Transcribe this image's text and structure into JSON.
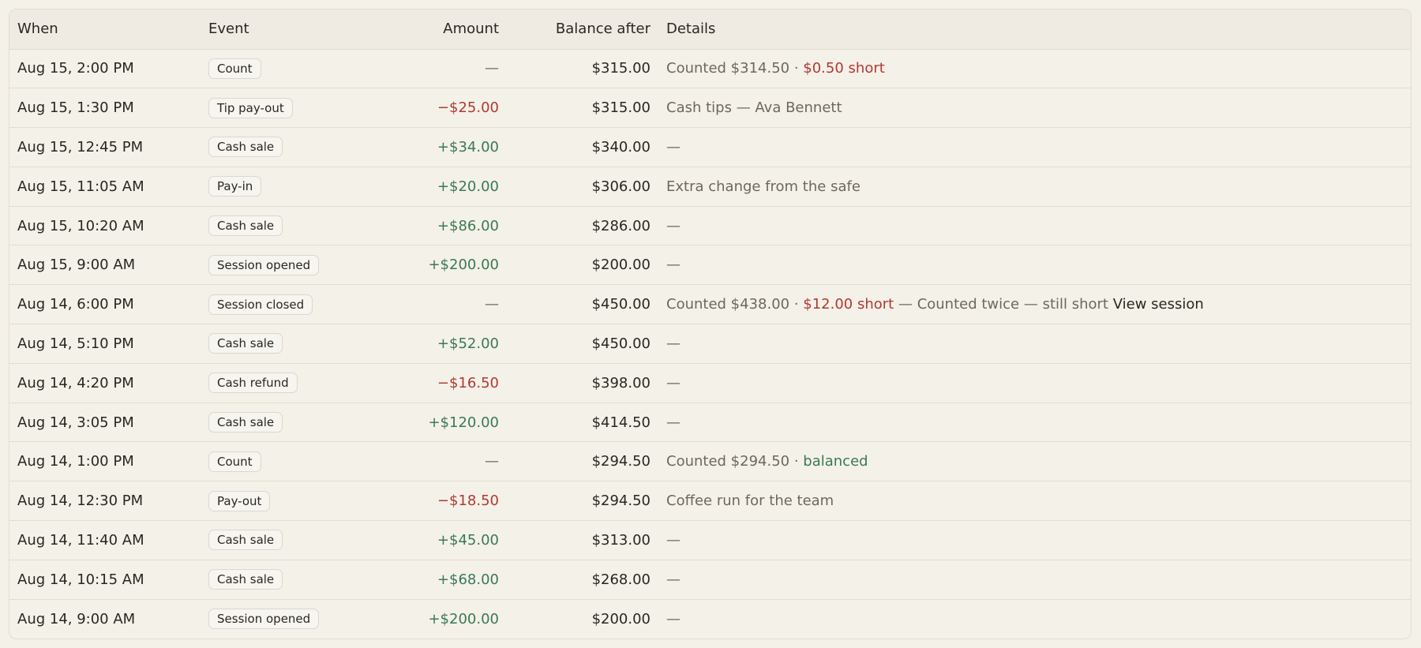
{
  "table": {
    "headers": {
      "when": "When",
      "event": "Event",
      "amount": "Amount",
      "balance": "Balance after",
      "details": "Details"
    },
    "rows": [
      {
        "when": "Aug 15, 2:00 PM",
        "event": "Count",
        "amount": "—",
        "amount_kind": "none",
        "balance": "$315.00",
        "details": "Counted $314.50 · ",
        "flag": "$0.50 short",
        "flag_kind": "short",
        "note": "",
        "link": ""
      },
      {
        "when": "Aug 15, 1:30 PM",
        "event": "Tip pay-out",
        "amount": "−$25.00",
        "amount_kind": "neg",
        "balance": "$315.00",
        "details": "Cash tips — Ava Bennett",
        "flag": "",
        "flag_kind": "",
        "note": "",
        "link": ""
      },
      {
        "when": "Aug 15, 12:45 PM",
        "event": "Cash sale",
        "amount": "+$34.00",
        "amount_kind": "pos",
        "balance": "$340.00",
        "details": "—",
        "flag": "",
        "flag_kind": "",
        "note": "",
        "link": ""
      },
      {
        "when": "Aug 15, 11:05 AM",
        "event": "Pay-in",
        "amount": "+$20.00",
        "amount_kind": "pos",
        "balance": "$306.00",
        "details": "Extra change from the safe",
        "flag": "",
        "flag_kind": "",
        "note": "",
        "link": ""
      },
      {
        "when": "Aug 15, 10:20 AM",
        "event": "Cash sale",
        "amount": "+$86.00",
        "amount_kind": "pos",
        "balance": "$286.00",
        "details": "—",
        "flag": "",
        "flag_kind": "",
        "note": "",
        "link": ""
      },
      {
        "when": "Aug 15, 9:00 AM",
        "event": "Session opened",
        "amount": "+$200.00",
        "amount_kind": "pos",
        "balance": "$200.00",
        "details": "—",
        "flag": "",
        "flag_kind": "",
        "note": "",
        "link": ""
      },
      {
        "when": "Aug 14, 6:00 PM",
        "event": "Session closed",
        "amount": "—",
        "amount_kind": "none",
        "balance": "$450.00",
        "details": "Counted $438.00 · ",
        "flag": "$12.00 short",
        "flag_kind": "short",
        "note": " — Counted twice — still short ",
        "link": "View session"
      },
      {
        "when": "Aug 14, 5:10 PM",
        "event": "Cash sale",
        "amount": "+$52.00",
        "amount_kind": "pos",
        "balance": "$450.00",
        "details": "—",
        "flag": "",
        "flag_kind": "",
        "note": "",
        "link": ""
      },
      {
        "when": "Aug 14, 4:20 PM",
        "event": "Cash refund",
        "amount": "−$16.50",
        "amount_kind": "neg",
        "balance": "$398.00",
        "details": "—",
        "flag": "",
        "flag_kind": "",
        "note": "",
        "link": ""
      },
      {
        "when": "Aug 14, 3:05 PM",
        "event": "Cash sale",
        "amount": "+$120.00",
        "amount_kind": "pos",
        "balance": "$414.50",
        "details": "—",
        "flag": "",
        "flag_kind": "",
        "note": "",
        "link": ""
      },
      {
        "when": "Aug 14, 1:00 PM",
        "event": "Count",
        "amount": "—",
        "amount_kind": "none",
        "balance": "$294.50",
        "details": "Counted $294.50 · ",
        "flag": "balanced",
        "flag_kind": "ok",
        "note": "",
        "link": ""
      },
      {
        "when": "Aug 14, 12:30 PM",
        "event": "Pay-out",
        "amount": "−$18.50",
        "amount_kind": "neg",
        "balance": "$294.50",
        "details": "Coffee run for the team",
        "flag": "",
        "flag_kind": "",
        "note": "",
        "link": ""
      },
      {
        "when": "Aug 14, 11:40 AM",
        "event": "Cash sale",
        "amount": "+$45.00",
        "amount_kind": "pos",
        "balance": "$313.00",
        "details": "—",
        "flag": "",
        "flag_kind": "",
        "note": "",
        "link": ""
      },
      {
        "when": "Aug 14, 10:15 AM",
        "event": "Cash sale",
        "amount": "+$68.00",
        "amount_kind": "pos",
        "balance": "$268.00",
        "details": "—",
        "flag": "",
        "flag_kind": "",
        "note": "",
        "link": ""
      },
      {
        "when": "Aug 14, 9:00 AM",
        "event": "Session opened",
        "amount": "+$200.00",
        "amount_kind": "pos",
        "balance": "$200.00",
        "details": "—",
        "flag": "",
        "flag_kind": "",
        "note": "",
        "link": ""
      }
    ]
  },
  "colors": {
    "positive": "#3a7a52",
    "negative": "#b03a32",
    "muted": "#6d685f",
    "background": "#f4f1e9"
  }
}
